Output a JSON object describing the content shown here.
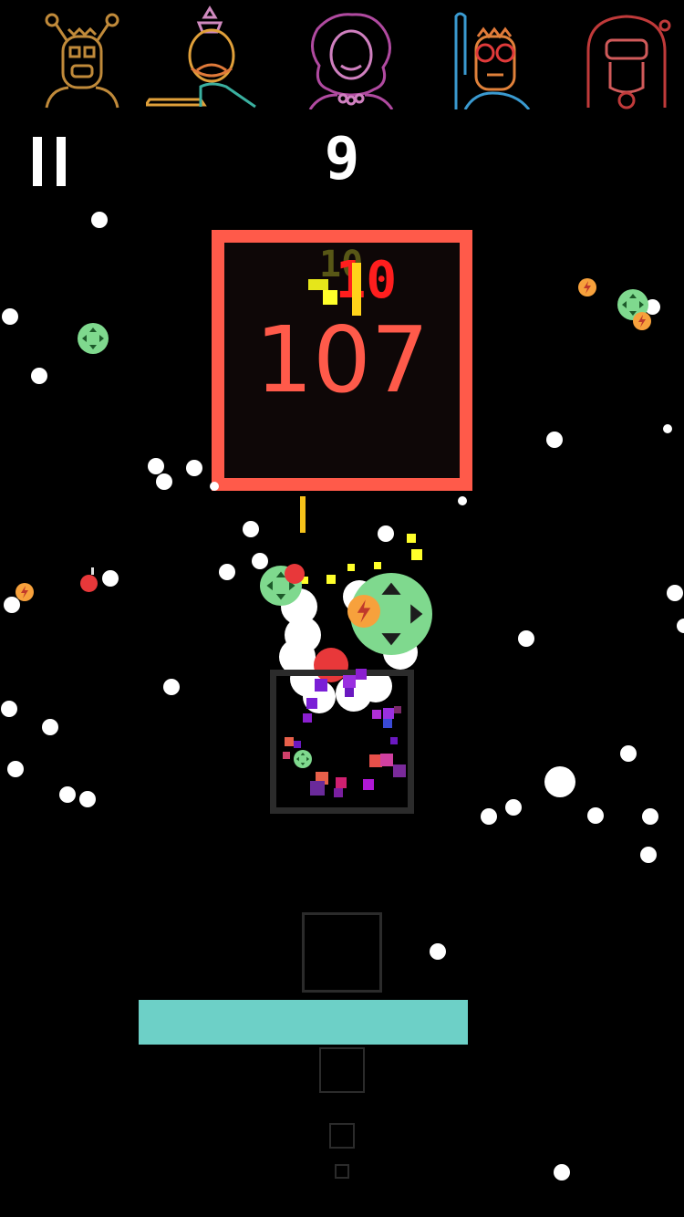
{
  "hud": {
    "score": "9",
    "pause_icon": "pause-icon"
  },
  "characters": [
    {
      "name": "alien-character-icon",
      "color": "#c08a3a"
    },
    {
      "name": "mustache-king-character-icon",
      "color": "#e07a3a"
    },
    {
      "name": "curly-hair-woman-character-icon",
      "color": "#b04aa0"
    },
    {
      "name": "glasses-man-character-icon",
      "color": "#e0813a"
    },
    {
      "name": "helmet-pilot-character-icon",
      "color": "#c03a3a"
    }
  ],
  "target_block": {
    "value": "107",
    "hit_text": "-10",
    "ghost_text": "10",
    "border_color": "#ff5a4a"
  },
  "paddle": {
    "color": "#6dd0c7"
  },
  "powerups": {
    "green_icon": "expand-arrows-icon",
    "orange_icon": "lightning-bolt-icon",
    "bomb_icon": "bomb-icon"
  }
}
